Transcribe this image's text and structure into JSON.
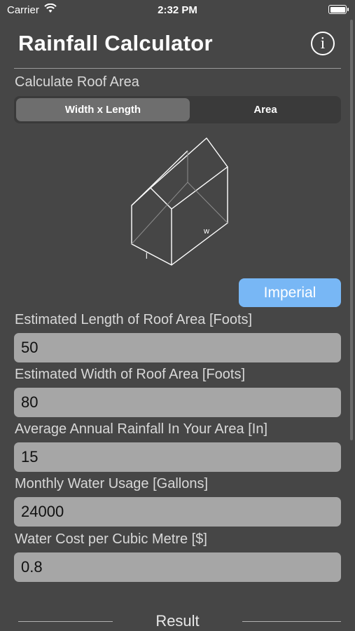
{
  "status_bar": {
    "carrier": "Carrier",
    "time": "2:32 PM"
  },
  "header": {
    "title": "Rainfall Calculator",
    "info_glyph": "i"
  },
  "roof_section": {
    "label": "Calculate Roof Area",
    "segments": [
      "Width x Length",
      "Area"
    ],
    "selected_segment": "Width x Length",
    "diagram_labels": {
      "width": "w",
      "length": "l"
    }
  },
  "unit_button": {
    "label": "Imperial"
  },
  "fields": [
    {
      "label": "Estimated Length of Roof Area [Foots]",
      "value": "50"
    },
    {
      "label": "Estimated Width of Roof Area [Foots]",
      "value": "80"
    },
    {
      "label": "Average Annual Rainfall In Your Area [In]",
      "value": "15"
    },
    {
      "label": "Monthly Water Usage [Gallons]",
      "value": "24000"
    },
    {
      "label": "Water Cost per Cubic Metre [$]",
      "value": "0.8"
    }
  ],
  "result": {
    "label": "Result"
  },
  "colors": {
    "background": "#464646",
    "accent": "#78b7f5",
    "input_bg": "#a6a6a6"
  }
}
